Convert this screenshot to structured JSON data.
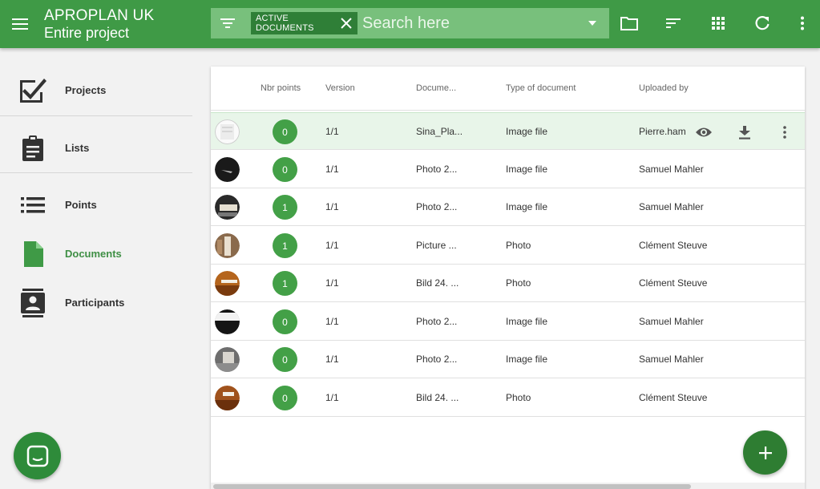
{
  "header": {
    "title": "APROPLAN UK",
    "subtitle": "Entire project",
    "filter_chip": "ACTIVE DOCUMENTS",
    "search_placeholder": "Search here"
  },
  "sidebar": {
    "items": [
      {
        "label": "Projects",
        "icon": "checklist-icon"
      },
      {
        "label": "Lists",
        "icon": "clipboard-icon"
      },
      {
        "label": "Points",
        "icon": "list-icon"
      },
      {
        "label": "Documents",
        "icon": "document-icon",
        "active": true
      },
      {
        "label": "Participants",
        "icon": "contacts-icon"
      }
    ]
  },
  "table": {
    "columns": [
      "Nbr points",
      "Version",
      "Docume...",
      "Type of document",
      "Uploaded by"
    ],
    "rows": [
      {
        "points": "0",
        "version": "1/1",
        "document": "Sina_Pla...",
        "type": "Image file",
        "uploaded_by": "Pierre.ham",
        "selected": true
      },
      {
        "points": "0",
        "version": "1/1",
        "document": "Photo 2...",
        "type": "Image file",
        "uploaded_by": "Samuel Mahler"
      },
      {
        "points": "1",
        "version": "1/1",
        "document": "Photo 2...",
        "type": "Image file",
        "uploaded_by": "Samuel Mahler"
      },
      {
        "points": "1",
        "version": "1/1",
        "document": "Picture ...",
        "type": "Photo",
        "uploaded_by": "Clément Steuve"
      },
      {
        "points": "1",
        "version": "1/1",
        "document": "Bild 24. ...",
        "type": "Photo",
        "uploaded_by": "Clément Steuve"
      },
      {
        "points": "0",
        "version": "1/1",
        "document": "Photo 2...",
        "type": "Image file",
        "uploaded_by": "Samuel Mahler"
      },
      {
        "points": "0",
        "version": "1/1",
        "document": "Photo 2...",
        "type": "Image file",
        "uploaded_by": "Samuel Mahler"
      },
      {
        "points": "0",
        "version": "1/1",
        "document": "Bild 24. ...",
        "type": "Photo",
        "uploaded_by": "Clément Steuve"
      }
    ]
  },
  "colors": {
    "primary": "#3f9a46",
    "search_bg": "#78c07c",
    "chip_bg": "#2f7f37",
    "badge": "#43a047",
    "selected_row": "#e8f5e9",
    "fab": "#2e7d32"
  }
}
